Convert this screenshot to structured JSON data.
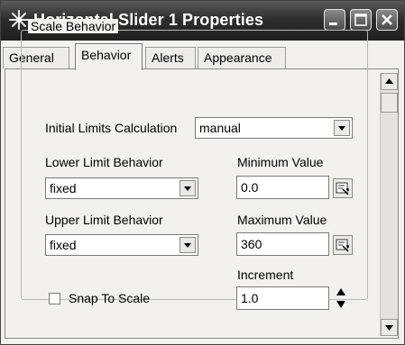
{
  "window": {
    "title": "Horizontal Slider 1 Properties",
    "app_icon": "star-burst-icon",
    "buttons": [
      "minimize-icon",
      "maximize-icon",
      "close-icon"
    ]
  },
  "tabs": [
    {
      "label": "General",
      "active": false
    },
    {
      "label": "Behavior",
      "active": true
    },
    {
      "label": "Alerts",
      "active": false
    },
    {
      "label": "Appearance",
      "active": false
    }
  ],
  "scale_behavior": {
    "group_title": "Scale Behavior",
    "initial_limits_label": "Initial Limits Calculation",
    "initial_limits_value": "manual",
    "lower_limit_label": "Lower Limit Behavior",
    "lower_limit_value": "fixed",
    "minimum_label": "Minimum Value",
    "minimum_value": "0.0",
    "upper_limit_label": "Upper Limit Behavior",
    "upper_limit_value": "fixed",
    "maximum_label": "Maximum Value",
    "maximum_value": "360",
    "increment_label": "Increment",
    "increment_value": "1.0",
    "snap_label": "Snap To Scale",
    "snap_checked": false
  },
  "colors": {
    "titlebar": "#2e2e2e",
    "panel_background": "#f3f1ee"
  }
}
